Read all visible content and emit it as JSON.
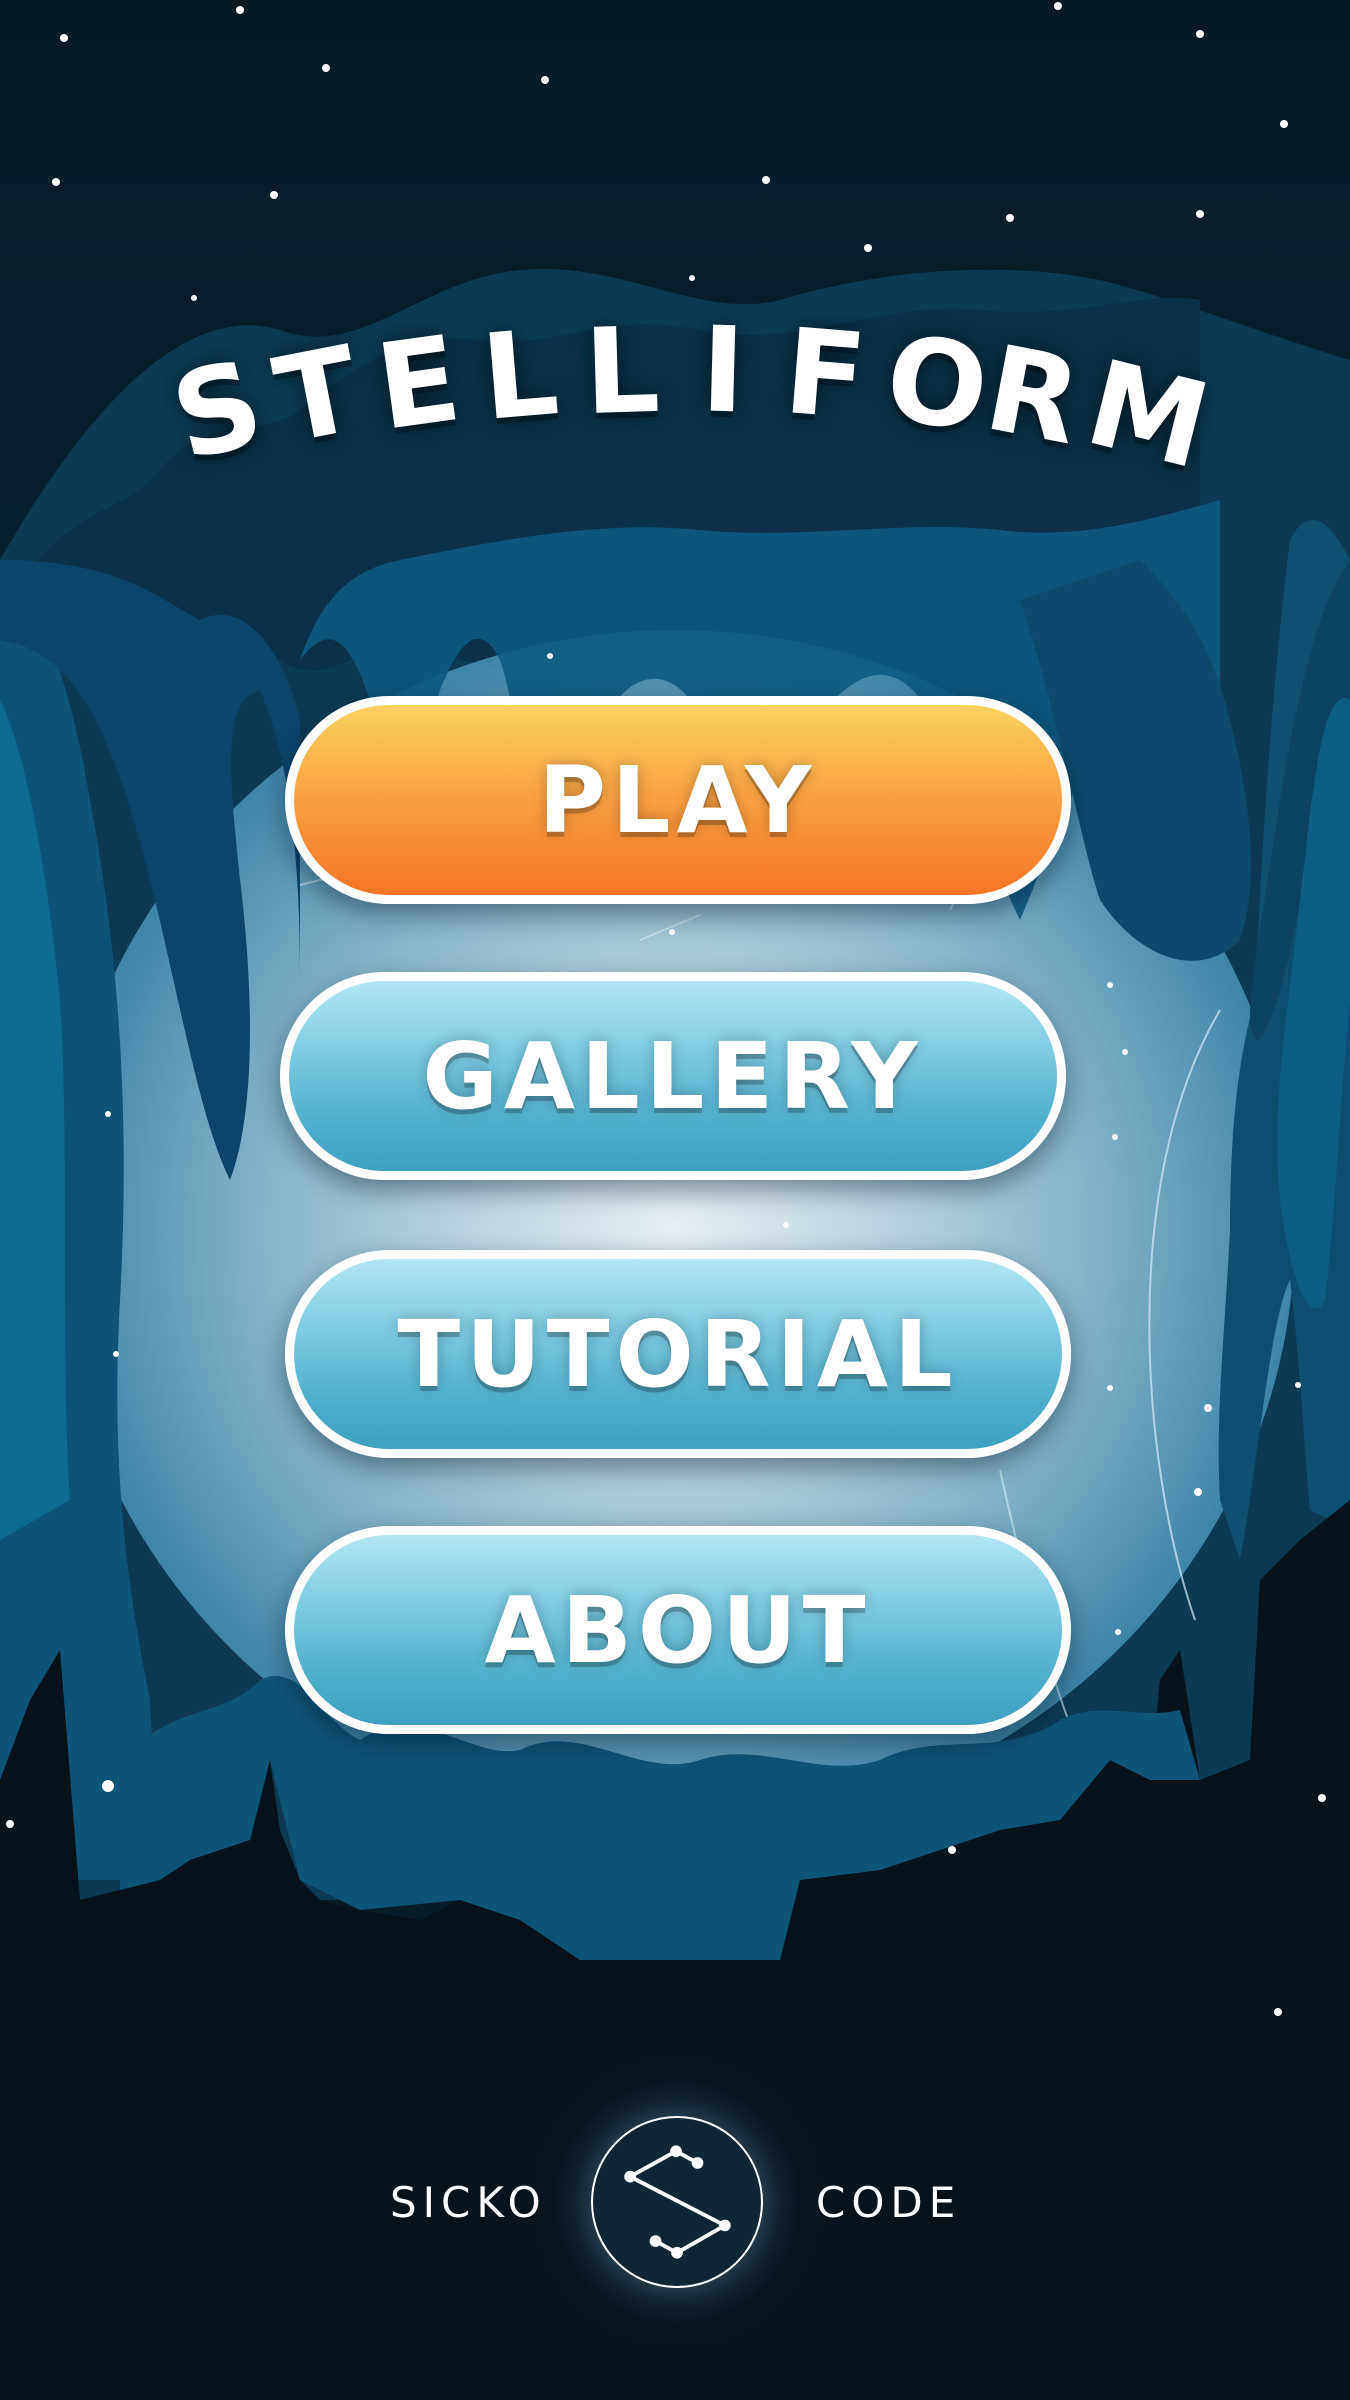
{
  "game": {
    "title": "STELLIFORM"
  },
  "menu": {
    "play_label": "PLAY",
    "gallery_label": "GALLERY",
    "tutorial_label": "TUTORIAL",
    "about_label": "ABOUT"
  },
  "studio": {
    "left_word": "SICKO",
    "right_word": "CODE",
    "logo_icon": "constellation-s-icon"
  },
  "colors": {
    "sky": "#07121b",
    "cave_dark": "#0b3246",
    "cave_mid": "#0d5577",
    "play_button_top": "#fcd160",
    "play_button_bottom": "#f47526",
    "menu_button_top": "#b3e6f3",
    "menu_button_bottom": "#3f9fc0",
    "button_border": "#ffffff"
  }
}
